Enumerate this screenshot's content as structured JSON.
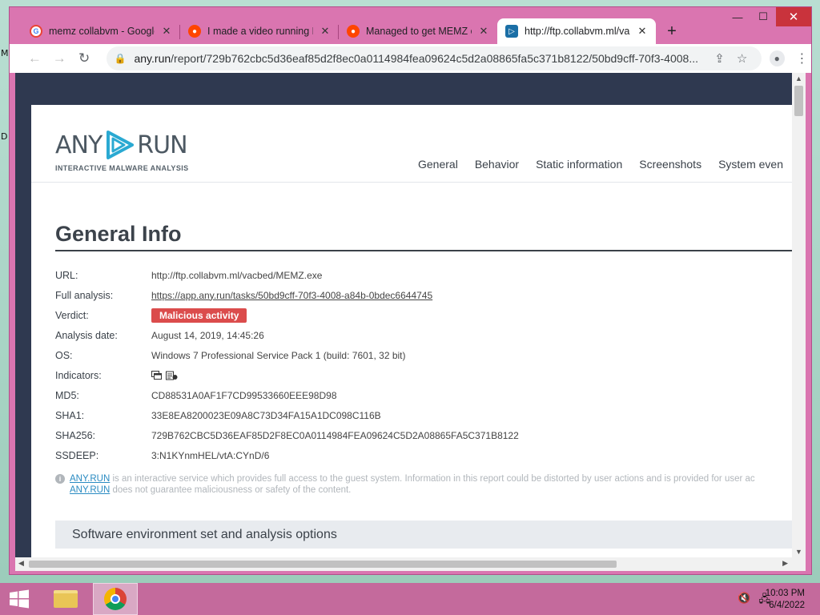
{
  "desktop": {
    "frag1": "M",
    "frag2": "D"
  },
  "window_controls": {
    "minimize": "—",
    "maximize": "☐",
    "close": "✕"
  },
  "tabs": [
    {
      "title": "memz collabvm - Google",
      "icon": "G",
      "close": "✕"
    },
    {
      "title": "I made a video running M",
      "icon": "●",
      "close": "✕"
    },
    {
      "title": "Managed to get MEMZ o",
      "icon": "●",
      "close": "✕"
    },
    {
      "title": "http://ftp.collabvm.ml/va",
      "icon": "▷",
      "close": "✕"
    }
  ],
  "new_tab": "+",
  "toolbar": {
    "back": "←",
    "forward": "→",
    "reload": "↻",
    "lock": "🔒",
    "url_host": "any.run",
    "url_path": "/report/729b762cbc5d36eaf85d2f8ec0a0114984fea09624c5d2a08865fa5c371b8122/50bd9cff-70f3-4008...",
    "share": "⇪",
    "star": "☆",
    "profile": "●",
    "menu": "⋮"
  },
  "site": {
    "logo_left": "ANY",
    "logo_right": "RUN",
    "logo_sub": "INTERACTIVE MALWARE ANALYSIS",
    "nav": [
      "General",
      "Behavior",
      "Static information",
      "Screenshots",
      "System even"
    ]
  },
  "general_info": {
    "title": "General Info",
    "rows": {
      "url": {
        "label": "URL:",
        "value": "http://ftp.collabvm.ml/vacbed/MEMZ.exe"
      },
      "full_analysis": {
        "label": "Full analysis:",
        "value": "https://app.any.run/tasks/50bd9cff-70f3-4008-a84b-0bdec6644745"
      },
      "verdict": {
        "label": "Verdict:",
        "value": "Malicious activity"
      },
      "analysis_date": {
        "label": "Analysis date:",
        "value": "August 14, 2019, 14:45:26"
      },
      "os": {
        "label": "OS:",
        "value": "Windows 7 Professional Service Pack 1 (build: 7601, 32 bit)"
      },
      "indicators": {
        "label": "Indicators:",
        "icons": [
          "window-icon",
          "registry-icon"
        ]
      },
      "md5": {
        "label": "MD5:",
        "value": "CD88531A0AF1F7CD99533660EEE98D98"
      },
      "sha1": {
        "label": "SHA1:",
        "value": "33E8EA8200023E09A8C73D34FA15A1DC098C116B"
      },
      "sha256": {
        "label": "SHA256:",
        "value": "729B762CBC5D36EAF85D2F8EC0A0114984FEA09624C5D2A08865FA5C371B8122"
      },
      "ssdeep": {
        "label": "SSDEEP:",
        "value": "3:N1KYnmHEL/vtA:CYnD/6"
      }
    }
  },
  "notice": {
    "icon": "i",
    "brand": "ANY.RUN",
    "line1_rest": " is an interactive service which provides full access to the guest system. Information in this report could be distorted by user actions and is provided for user ac",
    "line2_rest": " does not guarantee maliciousness or safety of the content."
  },
  "env_section": {
    "title": "Software environment set and analysis options"
  },
  "taskbar": {
    "clock_time": "10:03 PM",
    "clock_date": "6/4/2022",
    "volume_icon": "🔇",
    "network_icon": "🖧"
  },
  "colors": {
    "window_frame": "#da75b0",
    "taskbar": "#c46a9c",
    "verdict_red": "#db4c4c",
    "anyrun_blue": "#2a8bc2",
    "page_dark": "#2f3950"
  }
}
